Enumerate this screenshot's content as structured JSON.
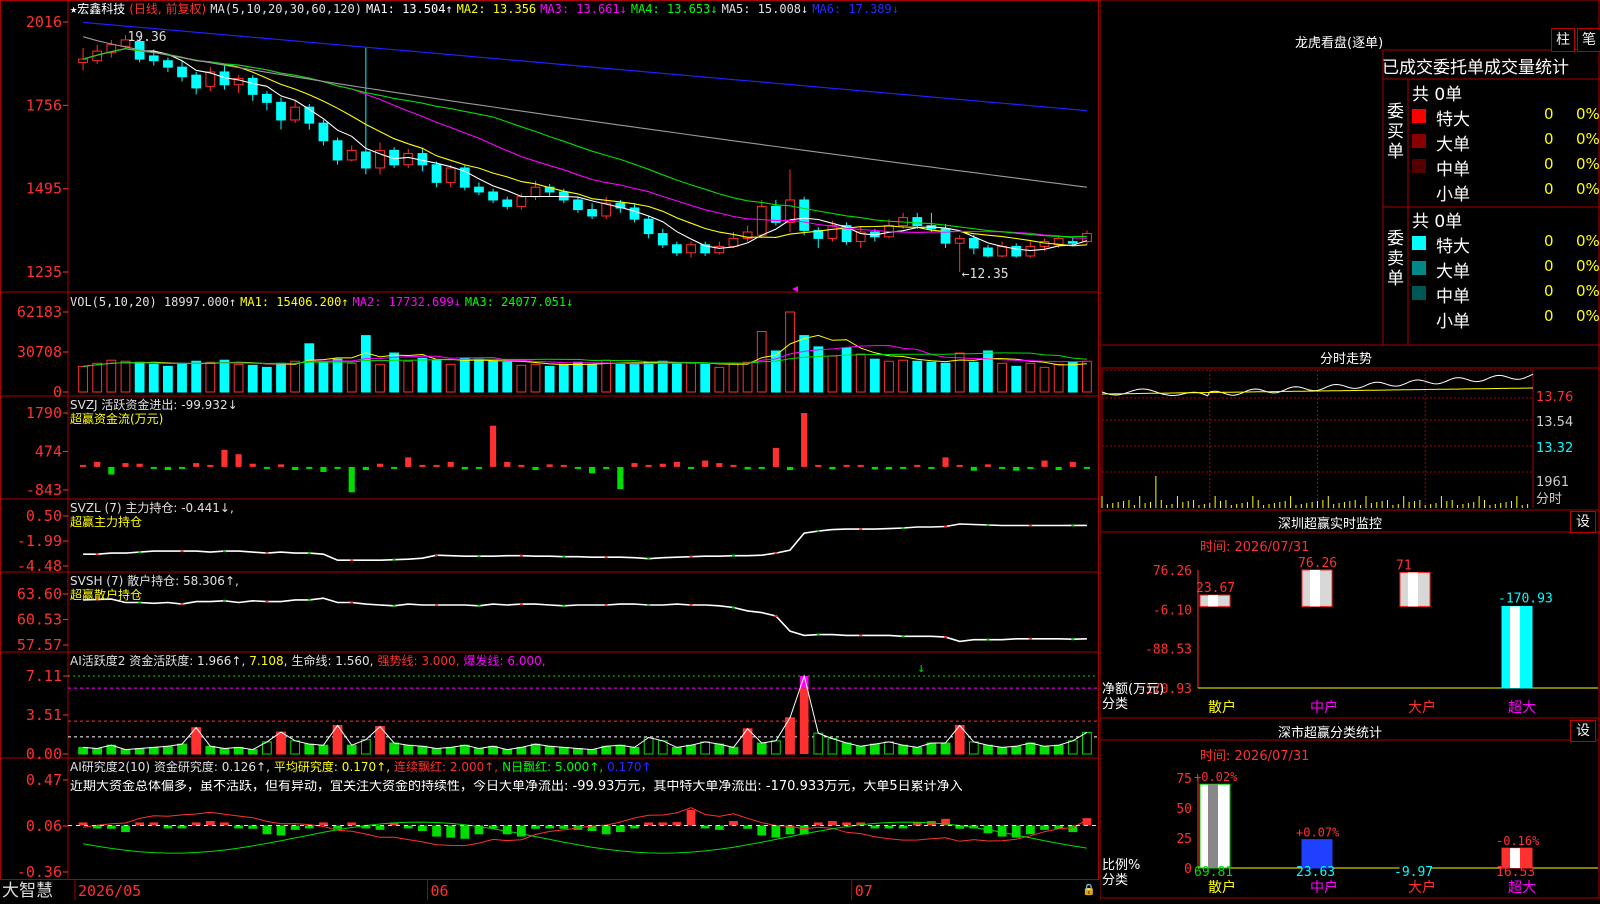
{
  "stock": {
    "name": "宏鑫科技",
    "star": "★",
    "mode": "(日线, 前复权)"
  },
  "colors": {
    "up": "#ff3030",
    "down": "#00ffff",
    "bg": "#000000",
    "frame": "#aa0000",
    "yellow": "#ffff00",
    "green": "#00dd00",
    "magenta": "#ff00ff",
    "blue": "#2020ff",
    "white": "#ffffff",
    "gray": "#9a9a9a"
  },
  "panels": {
    "main": {
      "ticks": [
        "2016",
        "1756",
        "1495",
        "1235"
      ],
      "header": [
        {
          "t": "MA(5,10,20,30,60,120)",
          "c": "#e0e0e0"
        },
        {
          "t": "MA1: 13.504↑",
          "c": "#ffffff"
        },
        {
          "t": "MA2: 13.356",
          "c": "#ffff00"
        },
        {
          "t": "MA3: 13.661↓",
          "c": "#ff00ff"
        },
        {
          "t": "MA4: 13.653↓",
          "c": "#00ff00"
        },
        {
          "t": "MA5: 15.008↓",
          "c": "#e0e0e0"
        },
        {
          "t": "MA6: 17.389↓",
          "c": "#2a2aff"
        }
      ],
      "annot_high": "19.36",
      "annot_low": "←12.35"
    },
    "vol": {
      "ticks": [
        "62183",
        "30708",
        "0"
      ],
      "header": [
        {
          "t": "VOL(5,10,20) 18997.000↑",
          "c": "#e0e0e0"
        },
        {
          "t": "MA1: 15406.200↑",
          "c": "#ffff00"
        },
        {
          "t": "MA2: 17732.699↓",
          "c": "#ff00ff"
        },
        {
          "t": "MA3: 24077.051↓",
          "c": "#00ff00"
        }
      ]
    },
    "svzj": {
      "ticks": [
        "1790",
        "474",
        "-843"
      ],
      "header": [
        {
          "t": "SVZJ  活跃资金进出: -99.932↓",
          "c": "#e0e0e0"
        }
      ],
      "sub": "超赢资金流(万元)"
    },
    "svzl": {
      "ticks": [
        "0.50",
        "-1.99",
        "-4.48"
      ],
      "header": [
        {
          "t": "SVZL (7) 主力持仓: -0.441↓,",
          "c": "#e0e0e0"
        }
      ],
      "sub": "超赢主力持仓"
    },
    "svsh": {
      "ticks": [
        "63.60",
        "60.53",
        "57.57"
      ],
      "header": [
        {
          "t": "SVSH (7) 散户持仓: 58.306↑,",
          "c": "#e0e0e0"
        }
      ],
      "sub": "超赢散户持仓"
    },
    "ai1": {
      "ticks": [
        "7.11",
        "3.51",
        "0.00"
      ],
      "header": [
        {
          "t": "AI活跃度2 资金活跃度: 1.966↑,",
          "c": "#e0e0e0"
        },
        {
          "t": "7.108,",
          "c": "#ffff00"
        },
        {
          "t": "生命线: 1.560,",
          "c": "#e0e0e0"
        },
        {
          "t": "强势线: 3.000,",
          "c": "#ff3030"
        },
        {
          "t": "爆发线: 6.000,",
          "c": "#ff00ff"
        }
      ]
    },
    "ai2": {
      "ticks": [
        "0.47",
        "0.06",
        "-0.36"
      ],
      "header": [
        {
          "t": "AI研究度2(10) 资金研究度: 0.126↑,",
          "c": "#e0e0e0"
        },
        {
          "t": "平均研究度: 0.170↑,",
          "c": "#ffff00"
        },
        {
          "t": "连续飘红: 2.000↑,",
          "c": "#ff3030"
        },
        {
          "t": "N日飘红: 5.000↑,",
          "c": "#00ff00"
        },
        {
          "t": "0.170↑",
          "c": "#2a2aff"
        }
      ],
      "comment": "近期大资金总体偏多，虽不活跃，但有异动，宜关注大资金的持续性，今日大单净流出: -99.93万元，其中特大单净流出: -170.933万元，大单5日累计净入"
    }
  },
  "xaxis": {
    "labels": [
      "2026/05",
      "06",
      "07"
    ],
    "brand": "大智慧"
  },
  "right": {
    "lhb": {
      "title": "龙虎看盘(逐单)",
      "btn_zhu": "柱",
      "btn_bi": "笔",
      "tab": "已成交委托单成交量统计",
      "buy": {
        "side": "委买单",
        "total": "共 0单",
        "rows": [
          {
            "k": "特大",
            "v": "0",
            "p": "0%",
            "c": "#ff0000"
          },
          {
            "k": "大单",
            "v": "0",
            "p": "0%",
            "c": "#880000"
          },
          {
            "k": "中单",
            "v": "0",
            "p": "0%",
            "c": "#550000"
          },
          {
            "k": "小单",
            "v": "0",
            "p": "0%",
            "c": ""
          }
        ]
      },
      "sell": {
        "side": "委卖单",
        "total": "共 0单",
        "rows": [
          {
            "k": "特大",
            "v": "0",
            "p": "0%",
            "c": "#00ffff"
          },
          {
            "k": "大单",
            "v": "0",
            "p": "0%",
            "c": "#008888"
          },
          {
            "k": "中单",
            "v": "0",
            "p": "0%",
            "c": "#005555"
          },
          {
            "k": "小单",
            "v": "0",
            "p": "0%",
            "c": ""
          }
        ]
      }
    },
    "fenshi": {
      "title": "分时走势",
      "ticks": [
        "13.76",
        "13.54",
        "13.32",
        "1961",
        "分时"
      ]
    },
    "monitor": {
      "title": "深圳超赢实时监控",
      "btn": "设",
      "time": "时间: 2026/07/31",
      "ticks": [
        "76.26",
        "-6.10",
        "-88.53",
        "-170.93"
      ],
      "ylabel": "净额(万元)",
      "xlabel": "分类",
      "chart_data": {
        "type": "bar",
        "categories": [
          "散户",
          "中户",
          "大户",
          "超大"
        ],
        "values": [
          23.67,
          76.26,
          71,
          -170.93
        ],
        "labels": [
          "23.67",
          "76.26",
          "71",
          "-170.93"
        ],
        "ylim": [
          -170.93,
          76.26
        ]
      }
    },
    "classify": {
      "title": "深市超赢分类统计",
      "btn": "设",
      "time": "时间: 2026/07/31",
      "ticks": [
        "75",
        "50",
        "25",
        "0"
      ],
      "ylabel": "比例%",
      "xlabel": "分类",
      "chart_data": {
        "type": "bar",
        "categories": [
          "散户",
          "中户",
          "大户",
          "超大"
        ],
        "values": [
          69.81,
          23.63,
          -9.97,
          16.53
        ],
        "pct": [
          "+0.02%",
          "+0.07%",
          "",
          "-0.16%"
        ],
        "ylim": [
          0,
          75
        ]
      }
    }
  },
  "chart_data": {
    "type": "candlestick",
    "y_range": [
      12.35,
      20.16
    ],
    "candles": [
      [
        18.9,
        19.0,
        19.35,
        18.65
      ],
      [
        18.95,
        19.25,
        19.45,
        18.85
      ],
      [
        19.2,
        19.45,
        19.6,
        19.05
      ],
      [
        19.4,
        19.6,
        19.75,
        19.3
      ],
      [
        19.55,
        19.0,
        19.7,
        18.9
      ],
      [
        19.1,
        18.95,
        19.3,
        18.8
      ],
      [
        18.95,
        18.75,
        19.05,
        18.6
      ],
      [
        18.75,
        18.45,
        18.95,
        18.3
      ],
      [
        18.5,
        18.1,
        18.6,
        17.9
      ],
      [
        18.15,
        18.6,
        18.75,
        18.0
      ],
      [
        18.6,
        18.2,
        18.8,
        18.05
      ],
      [
        18.2,
        18.4,
        18.5,
        17.95
      ],
      [
        18.4,
        17.9,
        18.5,
        17.7
      ],
      [
        17.9,
        17.65,
        18.0,
        17.4
      ],
      [
        17.65,
        17.1,
        17.8,
        16.8
      ],
      [
        17.1,
        17.5,
        17.7,
        17.0
      ],
      [
        17.5,
        17.0,
        17.6,
        16.8
      ],
      [
        17.0,
        16.45,
        17.1,
        16.3
      ],
      [
        16.45,
        15.85,
        16.55,
        15.7
      ],
      [
        15.85,
        16.15,
        16.3,
        15.8
      ],
      [
        16.1,
        15.6,
        19.36,
        15.4
      ],
      [
        15.6,
        16.15,
        16.4,
        15.4
      ],
      [
        16.15,
        15.7,
        16.25,
        15.6
      ],
      [
        15.7,
        16.05,
        16.2,
        15.6
      ],
      [
        16.05,
        15.7,
        16.2,
        15.5
      ],
      [
        15.7,
        15.15,
        15.8,
        15.0
      ],
      [
        15.15,
        15.6,
        15.7,
        15.0
      ],
      [
        15.6,
        15.0,
        15.7,
        14.9
      ],
      [
        15.0,
        14.85,
        15.15,
        14.75
      ],
      [
        14.85,
        14.6,
        14.95,
        14.5
      ],
      [
        14.6,
        14.4,
        14.7,
        14.3
      ],
      [
        14.4,
        14.7,
        14.8,
        14.3
      ],
      [
        14.7,
        15.0,
        15.2,
        14.6
      ],
      [
        15.0,
        14.85,
        15.1,
        14.7
      ],
      [
        14.85,
        14.6,
        14.95,
        14.5
      ],
      [
        14.6,
        14.3,
        14.7,
        14.2
      ],
      [
        14.3,
        14.1,
        14.5,
        14.0
      ],
      [
        14.1,
        14.5,
        14.7,
        14.0
      ],
      [
        14.5,
        14.35,
        14.6,
        14.2
      ],
      [
        14.35,
        14.0,
        14.5,
        13.9
      ],
      [
        14.0,
        13.55,
        14.1,
        13.4
      ],
      [
        13.55,
        13.2,
        13.7,
        13.1
      ],
      [
        13.2,
        12.95,
        13.3,
        12.85
      ],
      [
        12.95,
        13.2,
        13.3,
        12.8
      ],
      [
        13.2,
        12.95,
        13.3,
        12.85
      ],
      [
        12.95,
        13.15,
        13.3,
        12.9
      ],
      [
        13.15,
        13.4,
        13.6,
        13.1
      ],
      [
        13.4,
        13.6,
        13.8,
        13.3
      ],
      [
        13.5,
        14.4,
        14.6,
        13.4
      ],
      [
        14.4,
        13.9,
        14.6,
        13.8
      ],
      [
        13.9,
        14.6,
        15.55,
        13.6
      ],
      [
        14.6,
        13.65,
        14.7,
        13.5
      ],
      [
        13.65,
        13.4,
        13.75,
        13.1
      ],
      [
        13.4,
        13.8,
        13.95,
        13.3
      ],
      [
        13.8,
        13.3,
        13.9,
        13.2
      ],
      [
        13.3,
        13.6,
        13.75,
        13.1
      ],
      [
        13.6,
        13.45,
        13.7,
        13.3
      ],
      [
        13.45,
        13.8,
        14.0,
        13.4
      ],
      [
        13.8,
        14.05,
        14.2,
        13.7
      ],
      [
        14.05,
        13.8,
        14.2,
        13.7
      ],
      [
        13.8,
        13.7,
        14.2,
        13.6
      ],
      [
        13.7,
        13.25,
        13.85,
        13.1
      ],
      [
        13.25,
        13.4,
        13.5,
        12.35
      ],
      [
        13.4,
        13.1,
        13.5,
        12.9
      ],
      [
        13.1,
        12.85,
        13.2,
        12.8
      ],
      [
        12.85,
        13.15,
        13.3,
        12.8
      ],
      [
        13.15,
        12.85,
        13.25,
        12.8
      ],
      [
        12.85,
        13.15,
        13.3,
        12.8
      ],
      [
        13.15,
        13.3,
        13.4,
        13.0
      ],
      [
        13.2,
        13.4,
        13.5,
        13.1
      ],
      [
        13.3,
        13.25,
        13.45,
        13.2
      ],
      [
        13.3,
        13.55,
        13.65,
        13.2
      ]
    ],
    "volume": {
      "max": 62183,
      "values": [
        25,
        28,
        31,
        30,
        29,
        27,
        25,
        28,
        30,
        29,
        31,
        27,
        26,
        24,
        28,
        30,
        47,
        29,
        32,
        28,
        55,
        27,
        38,
        30,
        33,
        31,
        27,
        33,
        32,
        30,
        29,
        26,
        27,
        25,
        27,
        29,
        27,
        31,
        27,
        28,
        29,
        30,
        28,
        28,
        27,
        24,
        28,
        29,
        59,
        40,
        78,
        55,
        44,
        35,
        43,
        37,
        32,
        30,
        31,
        30,
        29,
        28,
        38,
        29,
        40,
        28,
        25,
        28,
        24,
        27,
        29,
        30
      ]
    },
    "svzj": {
      "range": [
        -843,
        1790
      ],
      "values": [
        3,
        8,
        -12,
        6,
        5,
        -3,
        -5,
        -2,
        6,
        1,
        27,
        20,
        5,
        -3,
        4,
        -5,
        -2,
        -8,
        -3,
        -40,
        -5,
        5,
        -2,
        15,
        0,
        3,
        8,
        -4,
        -2,
        65,
        8,
        2,
        -5,
        4,
        1,
        -2,
        -10,
        -3,
        -35,
        6,
        2,
        5,
        8,
        -2,
        10,
        6,
        2,
        -4,
        -3,
        30,
        -5,
        85,
        3,
        -4,
        2,
        3,
        -4,
        -4,
        -3,
        2,
        -3,
        15,
        2,
        -6,
        4,
        -3,
        -6,
        -3,
        10,
        -5,
        8,
        -3
      ]
    },
    "svzl": {
      "range": [
        -4.48,
        0.5
      ],
      "values": [
        -3.3,
        -3.3,
        -3.2,
        -3.2,
        -3.1,
        -3.0,
        -3.0,
        -3.0,
        -3.0,
        -3.1,
        -3.0,
        -3.0,
        -3.1,
        -3.2,
        -3.1,
        -3.2,
        -3.2,
        -3.3,
        -3.9,
        -3.9,
        -3.9,
        -3.9,
        -3.85,
        -3.8,
        -3.7,
        -3.4,
        -3.45,
        -3.5,
        -3.5,
        -3.5,
        -3.45,
        -3.45,
        -3.5,
        -3.5,
        -3.55,
        -3.55,
        -3.6,
        -3.6,
        -3.6,
        -3.65,
        -3.75,
        -3.65,
        -3.6,
        -3.55,
        -3.5,
        -3.5,
        -3.45,
        -3.45,
        -3.4,
        -3.2,
        -2.9,
        -1.2,
        -1.0,
        -0.85,
        -0.8,
        -0.8,
        -0.8,
        -0.75,
        -0.7,
        -0.6,
        -0.6,
        -0.55,
        -0.3,
        -0.35,
        -0.4,
        -0.45,
        -0.45,
        -0.45,
        -0.45,
        -0.45,
        -0.44,
        -0.441
      ]
    },
    "svsh": {
      "range": [
        57.57,
        63.6
      ],
      "values": [
        62.9,
        62.95,
        63.0,
        62.6,
        62.6,
        62.5,
        62.6,
        62.4,
        62.7,
        62.7,
        62.8,
        62.6,
        62.8,
        62.7,
        62.7,
        62.9,
        62.9,
        63.1,
        62.6,
        62.6,
        62.4,
        62.3,
        62.2,
        62.4,
        62.3,
        62.3,
        62.3,
        62.3,
        62.2,
        62.4,
        62.3,
        62.4,
        62.4,
        62.3,
        62.2,
        62.3,
        62.3,
        62.3,
        62.4,
        62.4,
        62.3,
        62.3,
        62.4,
        62.3,
        62.3,
        62.2,
        62.0,
        61.6,
        61.4,
        61.0,
        59.2,
        58.7,
        58.8,
        58.8,
        58.7,
        58.7,
        58.7,
        58.7,
        58.6,
        58.6,
        58.6,
        58.5,
        58.0,
        58.2,
        58.2,
        58.2,
        58.3,
        58.3,
        58.3,
        58.3,
        58.25,
        58.306
      ]
    },
    "ai1": {
      "range": [
        0,
        7.11
      ],
      "lines": {
        "life": 1.56,
        "strong": 3.0,
        "burst": 6.0
      },
      "values": [
        0.6,
        0.5,
        0.8,
        0.4,
        0.5,
        0.6,
        0.7,
        0.9,
        2.4,
        0.7,
        0.5,
        0.6,
        0.4,
        1.1,
        2.0,
        1.2,
        0.9,
        0.8,
        2.6,
        0.8,
        1.3,
        2.5,
        1.0,
        0.8,
        0.7,
        0.5,
        0.6,
        0.8,
        0.5,
        0.7,
        0.4,
        0.6,
        0.9,
        0.7,
        0.6,
        0.5,
        0.4,
        0.7,
        0.8,
        0.6,
        1.5,
        1.2,
        0.6,
        0.8,
        1.1,
        0.9,
        0.6,
        2.3,
        1.0,
        1.2,
        3.3,
        7.108,
        1.9,
        1.4,
        1.0,
        0.7,
        0.9,
        1.1,
        0.8,
        0.6,
        1.0,
        1.0,
        2.6,
        1.1,
        0.8,
        0.6,
        0.7,
        1.0,
        0.7,
        0.8,
        1.2,
        1.966
      ]
    },
    "ai2": {
      "range": [
        -0.36,
        0.47
      ],
      "values": [
        0.06,
        0.05,
        0.03,
        0.0,
        0.06,
        0.08,
        0.04,
        0.05,
        0.06,
        0.1,
        0.06,
        0.04,
        0.03,
        -0.02,
        -0.03,
        0.02,
        0.05,
        0.06,
        0.03,
        0.06,
        0.05,
        0.02,
        0.06,
        0.04,
        0.01,
        -0.04,
        -0.05,
        -0.06,
        -0.02,
        0.04,
        -0.02,
        -0.04,
        0.03,
        0.05,
        0.03,
        0.02,
        0.01,
        -0.02,
        0.0,
        0.05,
        0.08,
        0.06,
        0.09,
        0.2,
        0.05,
        0.02,
        0.1,
        0.03,
        -0.03,
        -0.05,
        -0.02,
        -0.02,
        0.07,
        0.1,
        0.06,
        0.08,
        0.05,
        0.04,
        0.04,
        0.06,
        0.1,
        0.12,
        0.03,
        0.05,
        -0.01,
        -0.04,
        -0.05,
        -0.02,
        0.02,
        0.03,
        0.0,
        0.126
      ]
    }
  }
}
